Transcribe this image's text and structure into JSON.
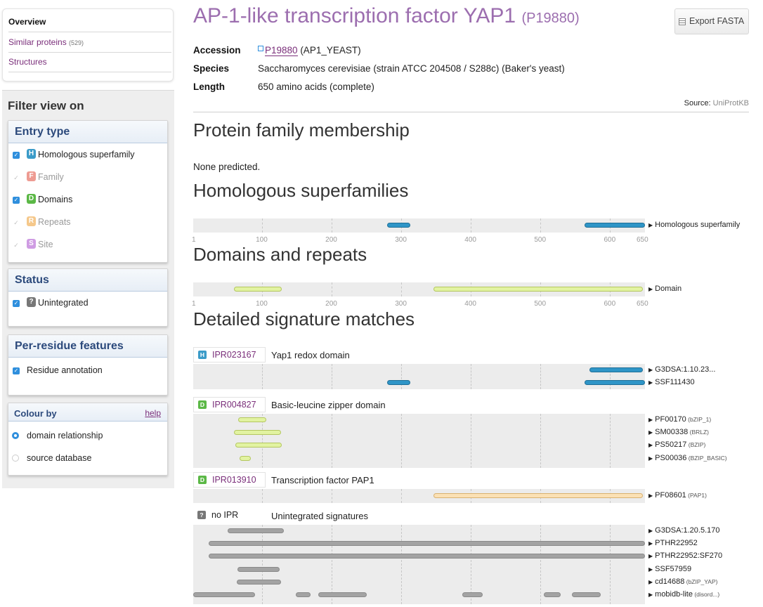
{
  "nav": {
    "overview": "Overview",
    "similar_label": "Similar proteins",
    "similar_count": "(529)",
    "structures": "Structures"
  },
  "filter": {
    "title": "Filter view on",
    "entry_type": {
      "heading": "Entry type",
      "items": [
        {
          "badge": "H",
          "label": "Homologous superfamily",
          "checked": true
        },
        {
          "badge": "F",
          "label": "Family",
          "checked": false
        },
        {
          "badge": "D",
          "label": "Domains",
          "checked": true
        },
        {
          "badge": "R",
          "label": "Repeats",
          "checked": false
        },
        {
          "badge": "S",
          "label": "Site",
          "checked": false
        }
      ]
    },
    "status": {
      "heading": "Status",
      "badge": "?",
      "label": "Unintegrated"
    },
    "per_residue": {
      "heading": "Per-residue features",
      "label": "Residue annotation"
    },
    "colour_by": {
      "heading": "Colour by",
      "help": "help",
      "options": [
        "domain relationship",
        "source database"
      ],
      "selected": "domain relationship"
    }
  },
  "protein": {
    "name": "AP-1-like transcription factor YAP1",
    "accession_paren": "(P19880)",
    "export_label": "Export FASTA",
    "accession_label": "Accession",
    "accession": "P19880",
    "accession_id": "(AP1_YEAST)",
    "species_label": "Species",
    "species": "Saccharomyces cerevisiae (strain ATCC 204508 / S288c) (Baker's yeast)",
    "length_label": "Length",
    "length": "650 amino acids (complete)",
    "source_label": "Source:",
    "source": "UniProtKB"
  },
  "sections": {
    "family": "Protein family membership",
    "none_predicted": "None predicted.",
    "superfamilies": "Homologous superfamilies",
    "domains": "Domains and repeats",
    "detailed": "Detailed signature matches"
  },
  "colors": {
    "homologous": "#2f95c7",
    "domain": "#e2f3a1",
    "pap1": "#fbe1b5",
    "unintegrated": "#a3a3a3",
    "badge_h": "#3b9bc8",
    "badge_f": "#e8695b",
    "badge_d": "#5bb846",
    "badge_r": "#f0a846",
    "badge_s": "#b36ed1",
    "badge_unint": "#777777",
    "link": "#7a2e7a"
  },
  "axis_ticks": [
    "1",
    "100",
    "200",
    "300",
    "400",
    "500",
    "600",
    "650"
  ],
  "tracks": {
    "superfamily": {
      "label": "Homologous superfamily",
      "segments": [
        {
          "start": 280,
          "end": 313
        },
        {
          "start": 563,
          "end": 650
        }
      ]
    },
    "domain": {
      "label": "Domain",
      "segments": [
        {
          "start": 60,
          "end": 128
        },
        {
          "start": 346,
          "end": 647
        }
      ]
    }
  },
  "entries": [
    {
      "type": "H",
      "id": "IPR023167",
      "name": "Yap1 redox domain",
      "color": "blue",
      "rows": [
        {
          "label": "G3DSA:1.10.23...",
          "sub": "",
          "segments": [
            {
              "start": 570,
              "end": 647
            }
          ]
        },
        {
          "label": "SSF111430",
          "sub": "",
          "segments": [
            {
              "start": 280,
              "end": 313
            },
            {
              "start": 563,
              "end": 650
            }
          ]
        }
      ]
    },
    {
      "type": "D",
      "id": "IPR004827",
      "name": "Basic-leucine zipper domain",
      "color": "green",
      "rows": [
        {
          "label": "PF00170",
          "sub": "(bZIP_1)",
          "segments": [
            {
              "start": 66,
              "end": 106
            }
          ]
        },
        {
          "label": "SM00338",
          "sub": "(BRLZ)",
          "segments": [
            {
              "start": 60,
              "end": 127
            }
          ]
        },
        {
          "label": "PS50217",
          "sub": "(BZIP)",
          "segments": [
            {
              "start": 62,
              "end": 128
            }
          ]
        },
        {
          "label": "PS00036",
          "sub": "(BZIP_BASIC)",
          "segments": [
            {
              "start": 68,
              "end": 84
            }
          ]
        }
      ]
    },
    {
      "type": "D",
      "id": "IPR013910",
      "name": "Transcription factor PAP1",
      "color": "orange",
      "rows": [
        {
          "label": "PF08601",
          "sub": "(PAP1)",
          "segments": [
            {
              "start": 346,
              "end": 647
            }
          ]
        }
      ]
    },
    {
      "type": "?",
      "id": "no IPR",
      "name": "Unintegrated signatures",
      "color": "grey",
      "rows": [
        {
          "label": "G3DSA:1.20.5.170",
          "sub": "",
          "segments": [
            {
              "start": 50,
              "end": 131
            }
          ]
        },
        {
          "label": "PTHR22952",
          "sub": "",
          "segments": [
            {
              "start": 23,
              "end": 650
            }
          ]
        },
        {
          "label": "PTHR22952:SF270",
          "sub": "",
          "segments": [
            {
              "start": 23,
              "end": 650
            }
          ]
        },
        {
          "label": "SSF57959",
          "sub": "",
          "segments": [
            {
              "start": 65,
              "end": 125
            }
          ]
        },
        {
          "label": "cd14688",
          "sub": "(bZIP_YAP)",
          "segments": [
            {
              "start": 64,
              "end": 127
            }
          ]
        },
        {
          "label": "mobidb-lite",
          "sub": "(disord...)",
          "segments": [
            {
              "start": 1,
              "end": 90
            },
            {
              "start": 148,
              "end": 170
            },
            {
              "start": 181,
              "end": 250
            },
            {
              "start": 388,
              "end": 417
            },
            {
              "start": 505,
              "end": 529
            },
            {
              "start": 545,
              "end": 586
            }
          ]
        }
      ]
    }
  ]
}
